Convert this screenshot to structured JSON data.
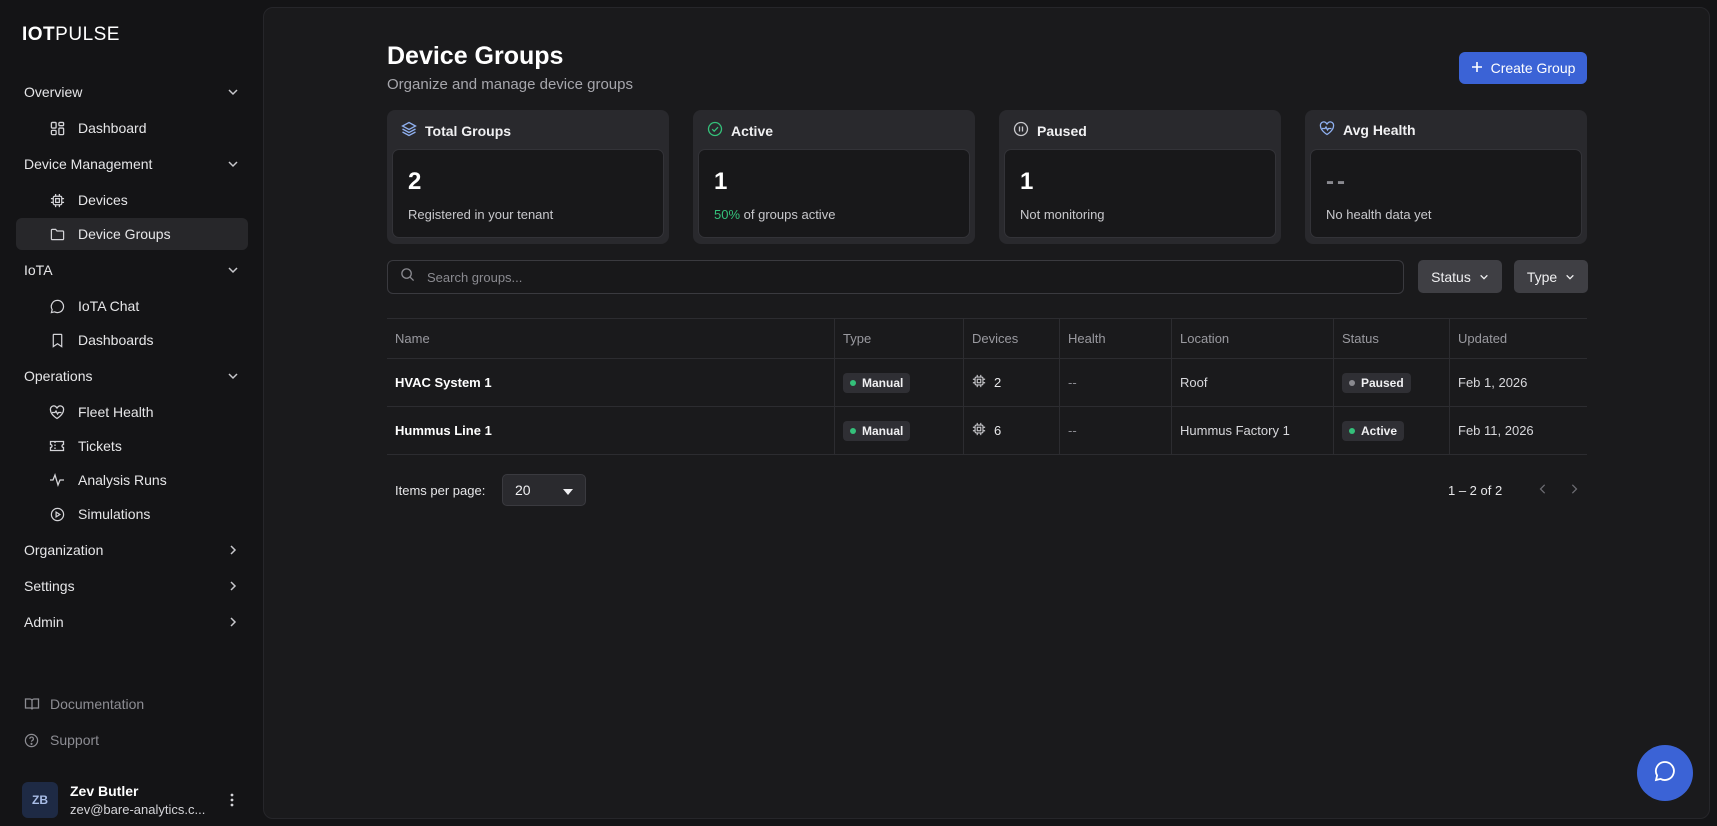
{
  "app": {
    "logo_bold": "IOT",
    "logo_light": "PULSE"
  },
  "sidebar": {
    "sections": [
      {
        "label": "Overview",
        "items": [
          {
            "label": "Dashboard",
            "icon": "dashboard-icon"
          }
        ]
      },
      {
        "label": "Device Management",
        "items": [
          {
            "label": "Devices",
            "icon": "chip-icon"
          },
          {
            "label": "Device Groups",
            "icon": "folder-icon"
          }
        ]
      },
      {
        "label": "IoTA",
        "items": [
          {
            "label": "IoTA Chat",
            "icon": "chat-icon"
          },
          {
            "label": "Dashboards",
            "icon": "bookmark-icon"
          }
        ]
      },
      {
        "label": "Operations",
        "items": [
          {
            "label": "Fleet Health",
            "icon": "heart-pulse-icon"
          },
          {
            "label": "Tickets",
            "icon": "ticket-icon"
          },
          {
            "label": "Analysis Runs",
            "icon": "activity-icon"
          },
          {
            "label": "Simulations",
            "icon": "play-circle-icon"
          }
        ]
      },
      {
        "label": "Organization"
      },
      {
        "label": "Settings"
      },
      {
        "label": "Admin"
      }
    ],
    "bottom": {
      "documentation": "Documentation",
      "support": "Support"
    },
    "user": {
      "initials": "ZB",
      "name": "Zev Butler",
      "email": "zev@bare-analytics.c..."
    }
  },
  "page": {
    "title": "Device Groups",
    "subtitle": "Organize and manage device groups",
    "create_label": "Create Group"
  },
  "stats": {
    "total": {
      "label": "Total Groups",
      "value": "2",
      "desc": "Registered in your tenant"
    },
    "active": {
      "label": "Active",
      "value": "1",
      "pct": "50%",
      "desc": " of groups active"
    },
    "paused": {
      "label": "Paused",
      "value": "1",
      "desc": "Not monitoring"
    },
    "health": {
      "label": "Avg Health",
      "value": "--",
      "desc": "No health data yet"
    }
  },
  "search": {
    "placeholder": "Search groups..."
  },
  "filters": {
    "status": "Status",
    "type": "Type"
  },
  "table": {
    "headers": [
      "Name",
      "Type",
      "Devices",
      "Health",
      "Location",
      "Status",
      "Updated"
    ],
    "rows": [
      {
        "name": "HVAC System 1",
        "type": "Manual",
        "devices": "2",
        "health": "--",
        "location": "Roof",
        "status": "Paused",
        "updated": "Feb 1, 2026"
      },
      {
        "name": "Hummus Line 1",
        "type": "Manual",
        "devices": "6",
        "health": "--",
        "location": "Hummus Factory 1",
        "status": "Active",
        "updated": "Feb 11, 2026"
      }
    ]
  },
  "pager": {
    "items_label": "Items per page:",
    "per_page": "20",
    "range": "1 – 2 of 2"
  },
  "colors": {
    "accent": "#3b63d6",
    "active_green": "#34c07a",
    "paused_gray": "#8a8a90",
    "type_green": "#34c07a"
  }
}
